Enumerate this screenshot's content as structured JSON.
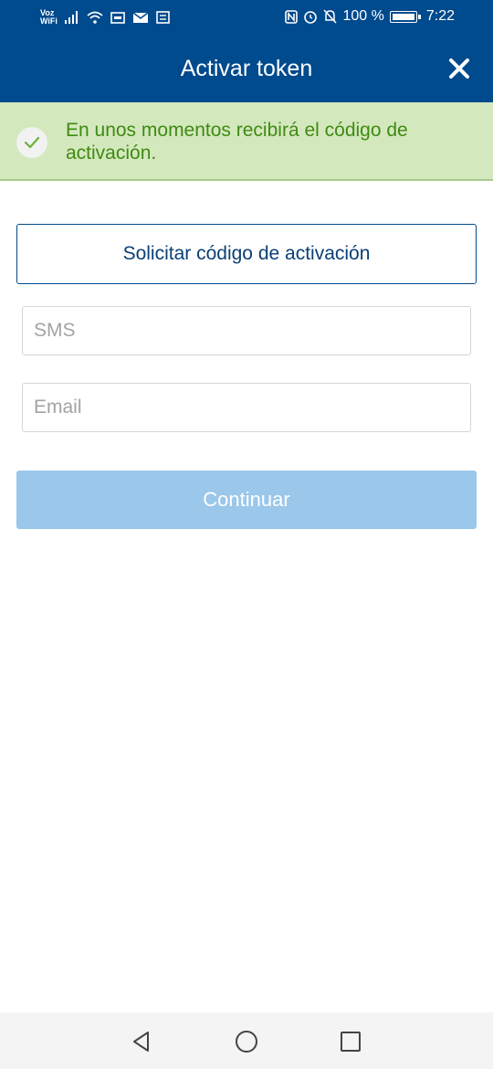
{
  "status_bar": {
    "carrier_top": "Voz",
    "carrier_bottom": "WiFi",
    "battery_text": "100 %",
    "time": "7:22",
    "icons": [
      "signal-icon",
      "wifi-icon",
      "sim-icon",
      "mail-icon",
      "notification-icon",
      "nfc-icon",
      "alarm-icon",
      "mute-icon",
      "battery-icon"
    ]
  },
  "header": {
    "title": "Activar token"
  },
  "toast": {
    "message": "En unos momentos recibirá el código de activación."
  },
  "form": {
    "request_button": "Solicitar código de activación",
    "sms_placeholder": "SMS",
    "email_placeholder": "Email",
    "continue_button": "Continuar"
  },
  "colors": {
    "primary": "#004a8e",
    "toast_bg": "#d4e8bd",
    "toast_text": "#3f8a14",
    "continue_disabled": "#9ac7ea"
  }
}
